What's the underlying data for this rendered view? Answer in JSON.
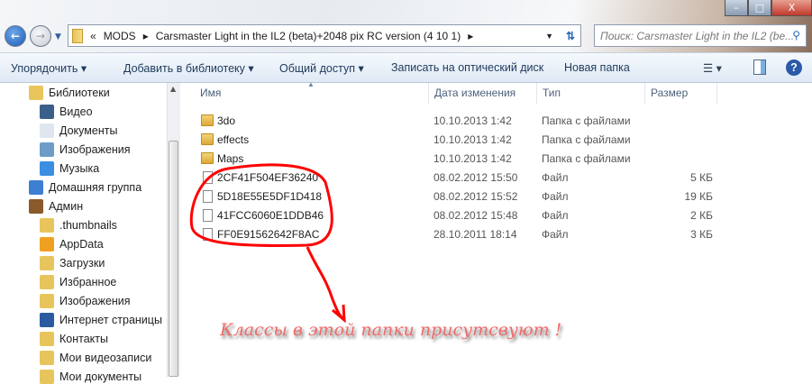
{
  "window": {
    "minimize": "–",
    "maximize": "□",
    "close": "X"
  },
  "address": {
    "prefix": "«",
    "crumbs": [
      "MODS",
      "Carsmaster Light in the IL2 (beta)+2048 pix RC version (4 10 1)"
    ],
    "separator": "▸"
  },
  "search": {
    "placeholder": "Поиск: Carsmaster Light in the IL2 (be..."
  },
  "toolbar": {
    "organize": "Упорядочить ▾",
    "add_library": "Добавить в библиотеку ▾",
    "share": "Общий доступ ▾",
    "burn": "Записать на оптический диск",
    "new_folder": "Новая папка"
  },
  "nav": {
    "items": [
      {
        "label": "Библиотеки",
        "icon": "library-icon",
        "color": "#e8c55c"
      },
      {
        "label": "Видео",
        "icon": "video-icon",
        "color": "#3a5f8a"
      },
      {
        "label": "Документы",
        "icon": "documents-icon",
        "color": "#dfe6ef"
      },
      {
        "label": "Изображения",
        "icon": "pictures-icon",
        "color": "#6d9dc6"
      },
      {
        "label": "Музыка",
        "icon": "music-icon",
        "color": "#3b8ee0"
      },
      {
        "label": "Домашняя группа",
        "icon": "homegroup-icon",
        "color": "#3d7fd0"
      },
      {
        "label": "Админ",
        "icon": "user-icon",
        "color": "#8a5a2a"
      },
      {
        "label": ".thumbnails",
        "icon": "folder-icon",
        "color": "#e8c55c"
      },
      {
        "label": "AppData",
        "icon": "appdata-icon",
        "color": "#f0a020"
      },
      {
        "label": "Загрузки",
        "icon": "downloads-icon",
        "color": "#e8c55c"
      },
      {
        "label": "Избранное",
        "icon": "favorites-icon",
        "color": "#e8c55c"
      },
      {
        "label": "Изображения",
        "icon": "pictures-folder-icon",
        "color": "#e8c55c"
      },
      {
        "label": "Интернет страницы",
        "icon": "ie-icon",
        "color": "#2a5aa0"
      },
      {
        "label": "Контакты",
        "icon": "contacts-icon",
        "color": "#e8c55c"
      },
      {
        "label": "Мои видеозаписи",
        "icon": "videos-folder-icon",
        "color": "#e8c55c"
      },
      {
        "label": "Мои документы",
        "icon": "docs-folder-icon",
        "color": "#e8c55c"
      }
    ]
  },
  "columns": {
    "name": "Имя",
    "date": "Дата изменения",
    "type": "Тип",
    "size": "Размер"
  },
  "files": [
    {
      "name": "3do",
      "date": "10.10.2013 1:42",
      "type": "Папка с файлами",
      "size": "",
      "kind": "folder"
    },
    {
      "name": "effects",
      "date": "10.10.2013 1:42",
      "type": "Папка с файлами",
      "size": "",
      "kind": "folder"
    },
    {
      "name": "Maps",
      "date": "10.10.2013 1:42",
      "type": "Папка с файлами",
      "size": "",
      "kind": "folder"
    },
    {
      "name": "2CF41F504EF36240",
      "date": "08.02.2012 15:50",
      "type": "Файл",
      "size": "5 КБ",
      "kind": "file"
    },
    {
      "name": "5D18E55E5DF1D418",
      "date": "08.02.2012 15:52",
      "type": "Файл",
      "size": "19 КБ",
      "kind": "file"
    },
    {
      "name": "41FCC6060E1DDB46",
      "date": "08.02.2012 15:48",
      "type": "Файл",
      "size": "2 КБ",
      "kind": "file"
    },
    {
      "name": "FF0E91562642F8AC",
      "date": "28.10.2011 18:14",
      "type": "Файл",
      "size": "3 КБ",
      "kind": "file"
    }
  ],
  "annotation": {
    "text": "Классы в этой папки присутсвуют !",
    "color": "#ff0000"
  }
}
